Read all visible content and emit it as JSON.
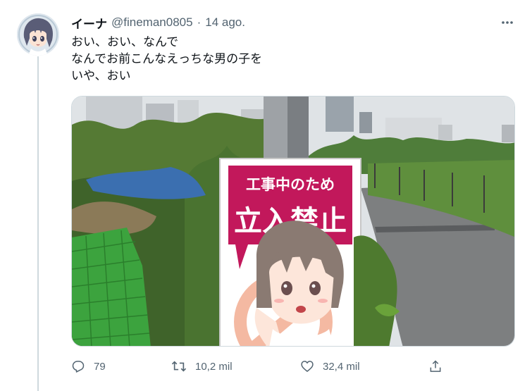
{
  "tweet": {
    "display_name": "イーナ",
    "handle": "@fineman0805",
    "separator": "·",
    "date": "14 ago.",
    "lines": [
      "おい、おい、なんで",
      "なんでお前こんなえっちな男の子を",
      "いや、おい"
    ],
    "image": {
      "sign_line1": "工事中のため",
      "sign_line2": "立入禁止"
    }
  },
  "actions": {
    "reply_count": "79",
    "retweet_count": "10,2 mil",
    "like_count": "32,4 mil"
  },
  "icons": {
    "more": "more-horizontal-icon",
    "reply": "reply-icon",
    "retweet": "retweet-icon",
    "like": "heart-icon",
    "share": "share-icon"
  },
  "colors": {
    "text": "#0f1419",
    "secondary": "#536471",
    "sign_magenta": "#c2185b"
  }
}
